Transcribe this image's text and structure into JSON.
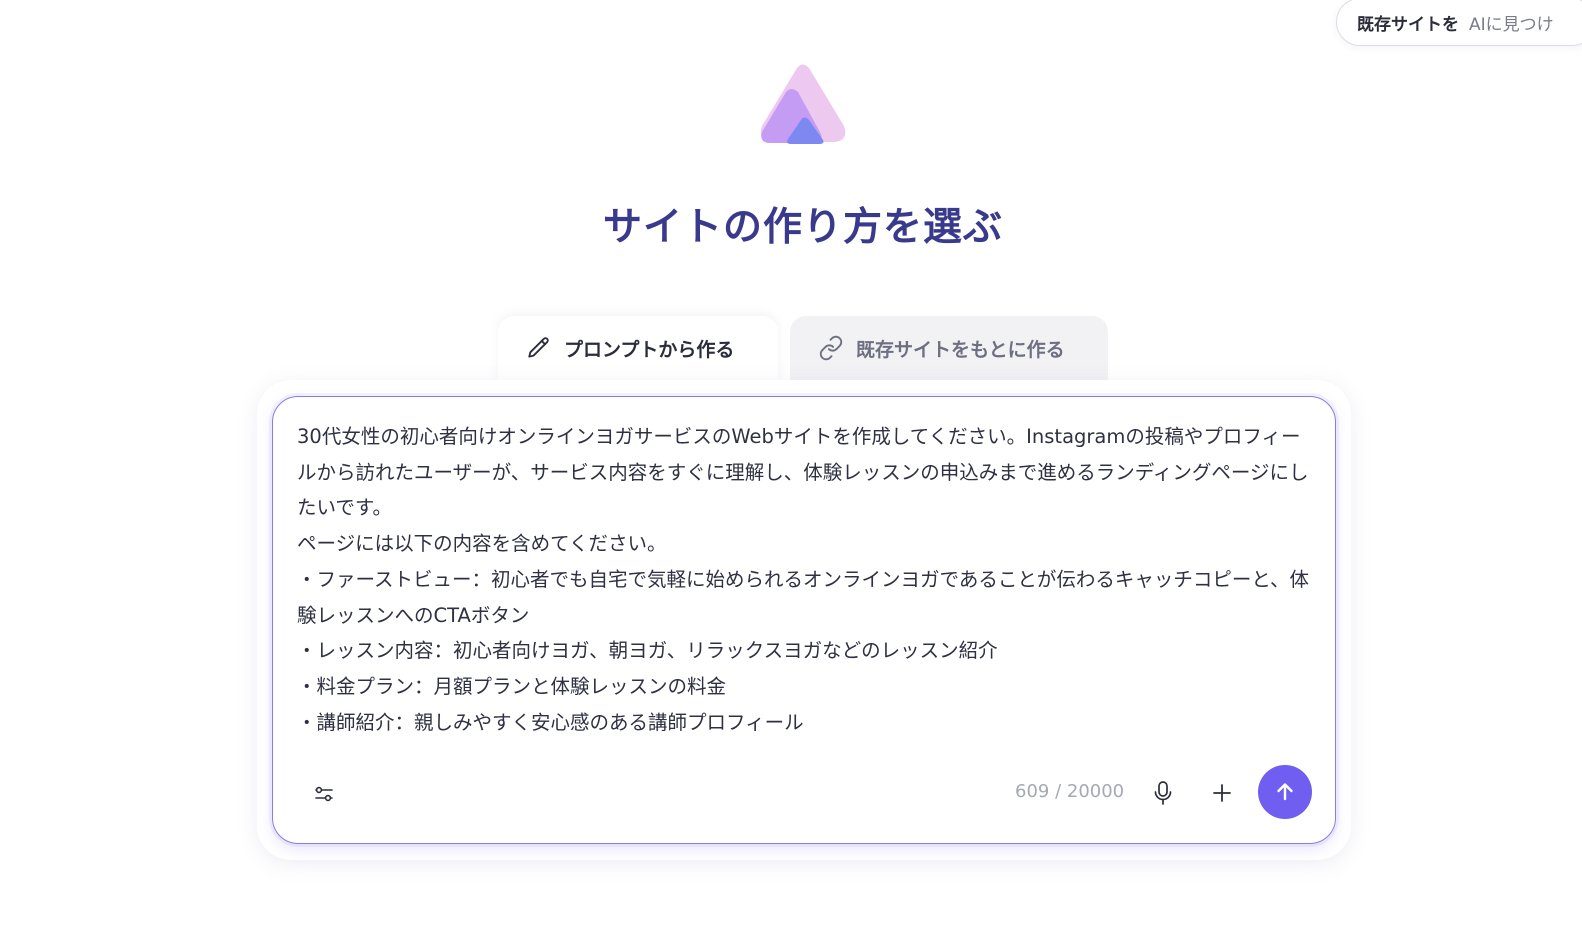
{
  "top_pill": {
    "strong": "既存サイトを",
    "sub": "AIに見つけ"
  },
  "header": {
    "title": "サイトの作り方を選ぶ"
  },
  "tabs": [
    {
      "label": "プロンプトから作る",
      "icon": "pencil-icon",
      "active": true
    },
    {
      "label": "既存サイトをもとに作る",
      "icon": "link-icon",
      "active": false
    }
  ],
  "prompt": {
    "value": "30代女性の初心者向けオンラインヨガサービスのWebサイトを作成してください。Instagramの投稿やプロフィールから訪れたユーザーが、サービス内容をすぐに理解し、体験レッスンの申込みまで進めるランディングページにしたいです。\nページには以下の内容を含めてください。\n・ファーストビュー：初心者でも自宅で気軽に始められるオンラインヨガであることが伝わるキャッチコピーと、体験レッスンへのCTAボタン\n・レッスン内容：初心者向けヨガ、朝ヨガ、リラックスヨガなどのレッスン紹介\n・料金プラン：月額プランと体験レッスンの料金\n・講師紹介：親しみやすく安心感のある講師プロフィール",
    "char_count": "609 / 20000"
  },
  "toolbar": {
    "settings_icon": "sliders-icon",
    "mic_icon": "microphone-icon",
    "plus_icon": "plus-icon",
    "send_icon": "arrow-up-icon"
  },
  "colors": {
    "accent": "#6f5ef0",
    "title": "#3a3a8c",
    "focus_border": "#8b7be8"
  }
}
